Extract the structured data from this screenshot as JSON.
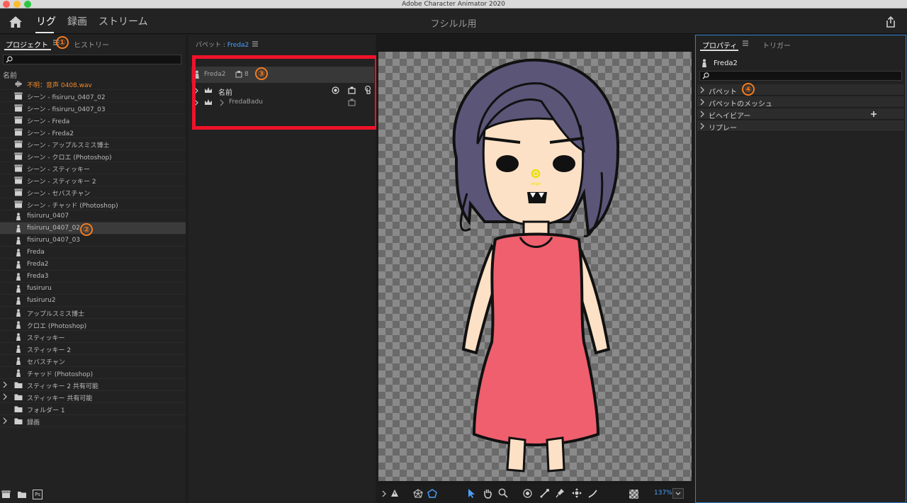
{
  "window": {
    "title": "Adobe Character Animator 2020"
  },
  "header": {
    "tabs": [
      {
        "label": "リグ",
        "active": true
      },
      {
        "label": "録画",
        "active": false
      },
      {
        "label": "ストリーム",
        "active": false
      }
    ],
    "document_title": "フシルル用"
  },
  "project_panel": {
    "tabs": [
      {
        "label": "プロジェクト",
        "active": true
      },
      {
        "label": "ヒストリー",
        "active": false
      }
    ],
    "search_placeholder": "",
    "column_header": "名前",
    "items": [
      {
        "label": "不明：音声 0408.wav",
        "icon": "audio-icon",
        "warn": true
      },
      {
        "label": "シーン - fisiruru_0407_02",
        "icon": "scene-icon"
      },
      {
        "label": "シーン - fisiruru_0407_03",
        "icon": "scene-icon"
      },
      {
        "label": "シーン - Freda",
        "icon": "scene-icon"
      },
      {
        "label": "シーン - Freda2",
        "icon": "scene-icon"
      },
      {
        "label": "シーン - アップルスミス博士",
        "icon": "scene-icon"
      },
      {
        "label": "シーン - クロエ (Photoshop)",
        "icon": "scene-icon"
      },
      {
        "label": "シーン - スティッキー",
        "icon": "scene-icon"
      },
      {
        "label": "シーン - スティッキー 2",
        "icon": "scene-icon"
      },
      {
        "label": "シーン - セバスチャン",
        "icon": "scene-icon"
      },
      {
        "label": "シーン - チャッド (Photoshop)",
        "icon": "scene-icon"
      },
      {
        "label": "fisiruru_0407",
        "icon": "puppet-icon"
      },
      {
        "label": "fisiruru_0407_02",
        "icon": "puppet-icon",
        "selected": true
      },
      {
        "label": "fisiruru_0407_03",
        "icon": "puppet-icon"
      },
      {
        "label": "Freda",
        "icon": "puppet-icon"
      },
      {
        "label": "Freda2",
        "icon": "puppet-icon"
      },
      {
        "label": "Freda3",
        "icon": "puppet-icon"
      },
      {
        "label": "fusiruru",
        "icon": "puppet-icon"
      },
      {
        "label": "fusiruru2",
        "icon": "puppet-icon"
      },
      {
        "label": "アップルスミス博士",
        "icon": "puppet-icon"
      },
      {
        "label": "クロエ (Photoshop)",
        "icon": "puppet-icon"
      },
      {
        "label": "スティッキー",
        "icon": "puppet-icon"
      },
      {
        "label": "スティッキー 2",
        "icon": "puppet-icon"
      },
      {
        "label": "セバスチャン",
        "icon": "puppet-icon"
      },
      {
        "label": "チャッド (Photoshop)",
        "icon": "puppet-icon"
      },
      {
        "label": "スティッキー 2 共有可能",
        "icon": "folder-icon",
        "expandable": true
      },
      {
        "label": "スティッキー 共有可能",
        "icon": "folder-icon",
        "expandable": true
      },
      {
        "label": "フォルダー 1",
        "icon": "folder-icon"
      },
      {
        "label": "録画",
        "icon": "folder-icon",
        "expandable": true
      }
    ],
    "bottom_tools": [
      "new-scene-icon",
      "new-folder-icon",
      "photoshop-icon"
    ],
    "ps_label": "Ps"
  },
  "puppet_panel": {
    "title_prefix": "パペット : ",
    "puppet_name": "Freda2",
    "top_row": {
      "name": "Freda2",
      "count": "8"
    },
    "rows": [
      {
        "name": "名前"
      },
      {
        "name": "FredaBadu"
      }
    ]
  },
  "canvas": {
    "origin_label": "origin",
    "zoom": "137%"
  },
  "properties_panel": {
    "tabs": [
      {
        "label": "プロパティ",
        "active": true
      },
      {
        "label": "トリガー",
        "active": false
      }
    ],
    "puppet_name": "Freda2",
    "sections": [
      {
        "label": "パペット"
      },
      {
        "label": "パペットのメッシュ"
      },
      {
        "label": "ビヘイビアー",
        "add": true
      },
      {
        "label": "リプレー"
      }
    ]
  },
  "annotations": [
    "①",
    "②",
    "③",
    "④"
  ],
  "colors": {
    "accent": "#4aa0ff",
    "highlight_box": "#f0122a",
    "badge": "#f47c20",
    "warning": "#f08a2a"
  }
}
